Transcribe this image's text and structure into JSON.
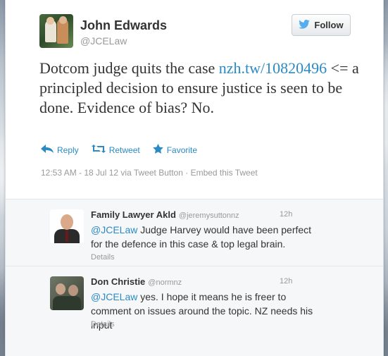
{
  "author": {
    "name": "John Edwards",
    "handle": "@JCELaw"
  },
  "follow_label": "Follow",
  "tweet": {
    "text_before": "Dotcom judge quits the case ",
    "link": "nzh.tw/10820496",
    "text_after": " <= a principled decision to ensure justice is seen to be done. Evidence of bias? No."
  },
  "actions": {
    "reply": "Reply",
    "retweet": "Retweet",
    "favorite": "Favorite"
  },
  "meta": "12:53 AM - 18 Jul 12 via Tweet Button · Embed this Tweet",
  "replies": [
    {
      "name": "Family Lawyer Akld",
      "handle": "@jeremysuttonnz",
      "time": "12h",
      "mention": "@JCELaw",
      "text": " Judge Harvey would have been perfect for the defence in this case & top legal brain.",
      "details": "Details"
    },
    {
      "name": "Don Christie",
      "handle": "@normnz",
      "time": "12h",
      "mention": "@JCELaw",
      "text": " yes. I hope it means he is freer to comment on issues around the topic. NZ needs his input",
      "details": "Details"
    }
  ],
  "colors": {
    "link": "#2b8ac4",
    "twitter_bird": "#55acee"
  }
}
